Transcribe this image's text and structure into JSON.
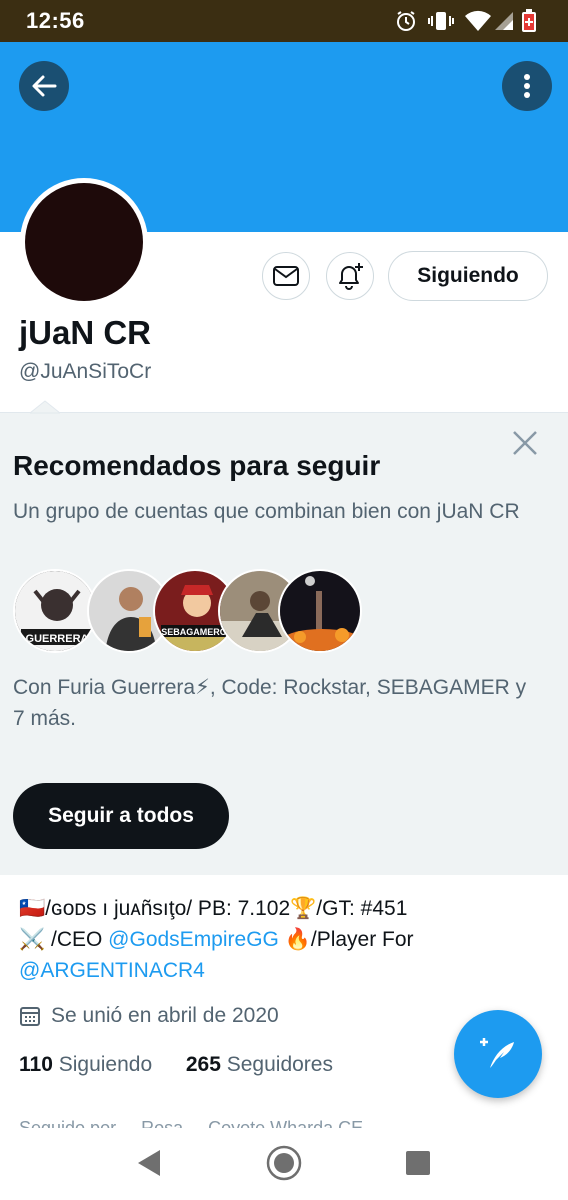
{
  "status_bar": {
    "time": "12:56",
    "icons": [
      "alarm-icon",
      "vibrate-icon",
      "wifi-icon",
      "signal-icon",
      "battery-icon"
    ]
  },
  "header": {
    "back_icon": "arrow-left-icon",
    "more_icon": "more-vertical-icon",
    "banner_color": "#1d9bf0"
  },
  "profile": {
    "name": "jUaN CR",
    "handle": "@JuAnSiToCr",
    "message_icon": "envelope-icon",
    "notify_icon": "bell-plus-icon",
    "follow_label": "Siguiendo"
  },
  "recommendations": {
    "title": "Recomendados para seguir",
    "subtitle": "Un grupo de cuentas que combinan bien con jUaN CR",
    "close_icon": "close-icon",
    "avatar_labels": [
      "GUERRERA",
      "",
      "SEBAGAMERCR",
      "",
      ""
    ],
    "with_text": "Con Furia Guerrera⚡, Code: Rockstar, SEBAGAMER y 7 más.",
    "follow_all_label": "Seguir a todos"
  },
  "bio": {
    "line1": "🇨🇱/ɢᴏᴅs ı juᴀñsıţᴏ/ PB: 7.102🏆/GT: #451",
    "line2_prefix": "⚔️ /CEO ",
    "mention1": "@GodsEmpireGG",
    "line2_suffix": " 🔥/Player For",
    "mention2": "@ARGENTINACR4",
    "joined": "Se unió en abril de 2020",
    "joined_icon": "calendar-icon",
    "following_count": "110",
    "following_label": "Siguiendo",
    "followers_count": "265",
    "followers_label": "Seguidores",
    "cutoff_text": "Seguido por ... Rosa ... Coyote Wharda CE"
  },
  "fab": {
    "icon": "compose-feather-icon"
  },
  "nav_bar": {
    "icons": [
      "back-triangle-icon",
      "home-circle-icon",
      "recents-square-icon"
    ]
  }
}
